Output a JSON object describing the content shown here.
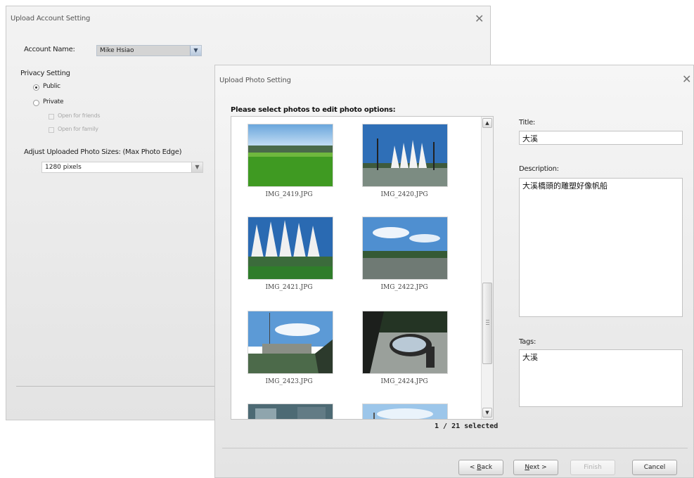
{
  "account_dialog": {
    "title": "Upload Account Setting",
    "close_glyph": "✕",
    "account_name_label": "Account Name:",
    "account_name_value": "Mike Hsiao",
    "privacy_label": "Privacy Setting",
    "public_label": "Public",
    "private_label": "Private",
    "friends_label": "Open for friends",
    "family_label": "Open for family",
    "privacy_selected": "Public",
    "size_label": "Adjust Uploaded Photo Sizes: (Max Photo Edge)",
    "size_value": "1280 pixels"
  },
  "photo_dialog": {
    "title": "Upload Photo Setting",
    "close_glyph": "✕",
    "select_heading": "Please select photos to edit photo options:",
    "photos": [
      {
        "name": "IMG_2419.JPG",
        "scene": "field"
      },
      {
        "name": "IMG_2420.JPG",
        "scene": "sails"
      },
      {
        "name": "IMG_2421.JPG",
        "scene": "sails-close"
      },
      {
        "name": "IMG_2422.JPG",
        "scene": "road"
      },
      {
        "name": "IMG_2423.JPG",
        "scene": "building"
      },
      {
        "name": "IMG_2424.JPG",
        "scene": "mirror"
      }
    ],
    "selection_count": "1 / 21 selected",
    "title_label": "Title:",
    "title_value": "大溪",
    "description_label": "Description:",
    "description_value": "大溪橋頭的雕塑好像帆船",
    "tags_label": "Tags:",
    "tags_value": "大溪",
    "buttons": {
      "back_prefix": "< ",
      "back_mnemonic": "B",
      "back_rest": "ack",
      "next_mnemonic": "N",
      "next_rest": "ext >",
      "finish": "Finish",
      "cancel": "Cancel"
    },
    "scroll_up_icon": "▲",
    "scroll_down_icon": "▼"
  }
}
